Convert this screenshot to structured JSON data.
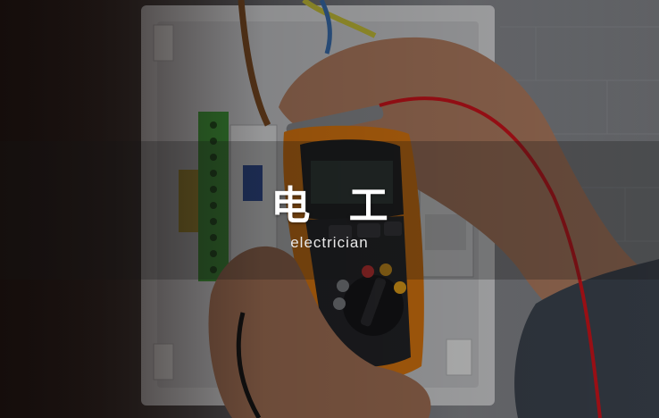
{
  "caption": {
    "title": "电 工",
    "subtitle": "electrician"
  },
  "colors": {
    "meter_body": "#e07a10",
    "probe_wire": "#d0141c",
    "terminal_block": "#3f9a3a",
    "panel_white": "#e6e7e9"
  }
}
